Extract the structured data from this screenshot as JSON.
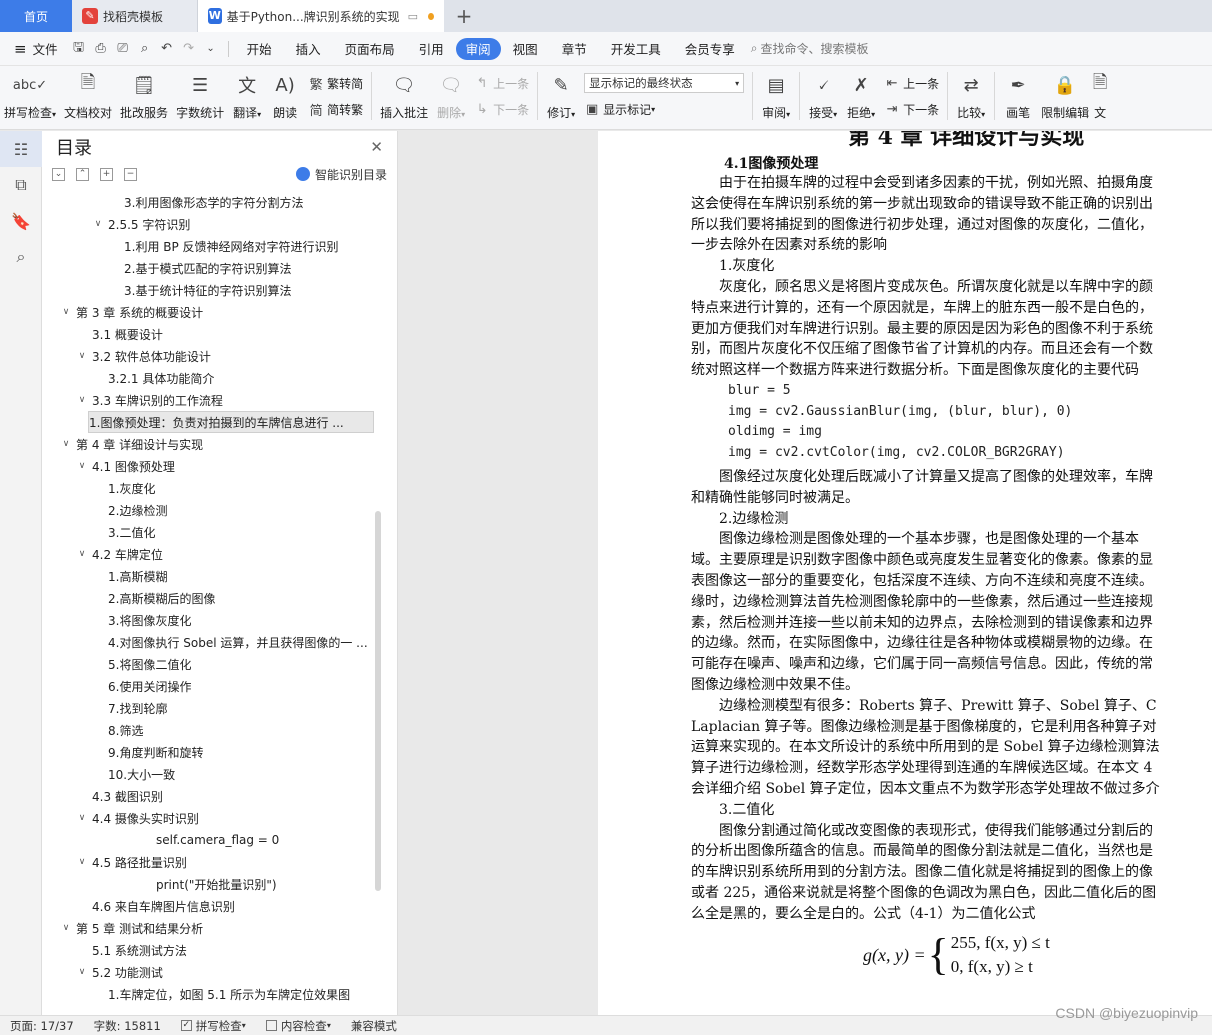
{
  "tabs": [
    {
      "label": "首页"
    },
    {
      "label": "找稻壳模板",
      "icon": "docer-icon"
    },
    {
      "label": "基于Python...牌识别系统的实现",
      "icon": "wps-writer-icon"
    }
  ],
  "menu": {
    "file": "文件",
    "items": [
      "开始",
      "插入",
      "页面布局",
      "引用",
      "审阅",
      "视图",
      "章节",
      "开发工具",
      "会员专享"
    ],
    "active": "审阅",
    "search_placeholder": "查找命令、搜索模板"
  },
  "ribbon": {
    "spellcheck": "拼写检查",
    "proofread": "文档校对",
    "batch": "批改服务",
    "wordcount": "字数统计",
    "translate": "翻译",
    "read": "朗读",
    "to_traditional": "繁转简",
    "to_simplified": "简转繁",
    "insert_comment": "插入批注",
    "delete": "删除",
    "prev": "上一条",
    "next": "下一条",
    "revise": "修订",
    "markup_select": "显示标记的最终状态",
    "show_markup": "显示标记",
    "review": "审阅",
    "accept": "接受",
    "reject": "拒绝",
    "prev2": "上一条",
    "next2": "下一条",
    "compare": "比较",
    "pen": "画笔",
    "restrict": "限制编辑",
    "doc_edge": "文"
  },
  "toc": {
    "title": "目录",
    "smart": "智能识别目录",
    "items": [
      {
        "text": "3.利用图像形态学的字符分割方法",
        "level": 3
      },
      {
        "text": "2.5.5 字符识别",
        "level": 2,
        "chev": "v"
      },
      {
        "text": "1.利用 BP 反馈神经网络对字符进行识别",
        "level": 3
      },
      {
        "text": "2.基于模式匹配的字符识别算法",
        "level": 3
      },
      {
        "text": "3.基于统计特征的字符识别算法",
        "level": 3
      },
      {
        "text": "第 3 章  系统的概要设计",
        "level": 0,
        "chev": "v"
      },
      {
        "text": "3.1 概要设计",
        "level": 1
      },
      {
        "text": "3.2 软件总体功能设计",
        "level": 1,
        "chev": "v"
      },
      {
        "text": "3.2.1 具体功能简介",
        "level": 2
      },
      {
        "text": "3.3 车牌识别的工作流程",
        "level": 1,
        "chev": "v"
      },
      {
        "text": "1.图像预处理：负责对拍摄到的车牌信息进行 ...",
        "level": 2,
        "selected": true
      },
      {
        "text": "第 4 章  详细设计与实现",
        "level": 0,
        "chev": "v"
      },
      {
        "text": "4.1 图像预处理",
        "level": 1,
        "chev": "v"
      },
      {
        "text": "1.灰度化",
        "level": 2
      },
      {
        "text": "2.边缘检测",
        "level": 2
      },
      {
        "text": "3.二值化",
        "level": 2
      },
      {
        "text": "4.2 车牌定位",
        "level": 1,
        "chev": "v"
      },
      {
        "text": "1.高斯模糊",
        "level": 2
      },
      {
        "text": "2.高斯模糊后的图像",
        "level": 2
      },
      {
        "text": "3.将图像灰度化",
        "level": 2
      },
      {
        "text": "4.对图像执行 Sobel 运算，并且获得图像的一 ...",
        "level": 2
      },
      {
        "text": "5.将图像二值化",
        "level": 2
      },
      {
        "text": "6.使用关闭操作",
        "level": 2
      },
      {
        "text": "7.找到轮廓",
        "level": 2
      },
      {
        "text": "8.筛选",
        "level": 2
      },
      {
        "text": "9.角度判断和旋转",
        "level": 2
      },
      {
        "text": "10.大小一致",
        "level": 2
      },
      {
        "text": "4.3 截图识别",
        "level": 1
      },
      {
        "text": "4.4 摄像头实时识别",
        "level": 1,
        "chev": "v"
      },
      {
        "text": "self.camera_flag = 0",
        "level": 4
      },
      {
        "text": "4.5 路径批量识别",
        "level": 1,
        "chev": "v"
      },
      {
        "text": "print(\"开始批量识别\")",
        "level": 4
      },
      {
        "text": "4.6 来自车牌图片信息识别",
        "level": 1
      },
      {
        "text": "第 5 章  测试和结果分析",
        "level": 0,
        "chev": "v"
      },
      {
        "text": "5.1 系统测试方法",
        "level": 1
      },
      {
        "text": "5.2 功能测试",
        "level": 1,
        "chev": "v"
      },
      {
        "text": "1.车牌定位，如图 5.1 所示为车牌定位效果图",
        "level": 2
      }
    ]
  },
  "doc": {
    "chapter": "第 4 章  详细设计与实现",
    "section": "4.1图像预处理",
    "lines": [
      "　　由于在拍摄车牌的过程中会受到诸多因素的干扰，例如光照、拍摄角度",
      "这会使得在车牌识别系统的第一步就出现致命的错误导致不能正确的识别出",
      "所以我们要将捕捉到的图像进行初步处理，通过对图像的灰度化，二值化，",
      "一步去除外在因素对系统的影响",
      "　　1.灰度化",
      "　　灰度化，顾名思义是将图片变成灰色。所谓灰度化就是以车牌中字的颜",
      "特点来进行计算的，还有一个原因就是，车牌上的脏东西一般不是白色的，",
      "更加方便我们对车牌进行识别。最主要的原因是因为彩色的图像不利于系统",
      "别，而图片灰度化不仅压缩了图像节省了计算机的内存。而且还会有一个数",
      "统对照这样一个数据方阵来进行数据分析。下面是图像灰度化的主要代码"
    ],
    "code": [
      "blur = 5",
      "img = cv2.GaussianBlur(img, (blur, blur), 0)",
      "oldimg = img",
      "img = cv2.cvtColor(img, cv2.COLOR_BGR2GRAY)"
    ],
    "lines2": [
      "　　图像经过灰度化处理后既减小了计算量又提高了图像的处理效率，车牌",
      "和精确性能够同时被满足。",
      "　　2.边缘检测",
      "　　图像边缘检测是图像处理的一个基本步骤，也是图像处理的一个基本",
      "域。主要原理是识别数字图像中颜色或亮度发生显著变化的像素。像素的显",
      "表图像这一部分的重要变化，包括深度不连续、方向不连续和亮度不连续。",
      "缘时，边缘检测算法首先检测图像轮廓中的一些像素，然后通过一些连接规",
      "素，然后检测并连接一些以前未知的边界点，去除检测到的错误像素和边界",
      "的边缘。然而，在实际图像中，边缘往往是各种物体或模糊景物的边缘。在",
      "可能存在噪声、噪声和边缘，它们属于同一高频信号信息。因此，传统的常",
      "图像边缘检测中效果不佳。",
      "　　边缘检测模型有很多：Roberts 算子、Prewitt 算子、Sobel 算子、C",
      "Laplacian 算子等。图像边缘检测是基于图像梯度的，它是利用各种算子对",
      "运算来实现的。在本文所设计的系统中所用到的是 Sobel 算子边缘检测算法",
      "算子进行边缘检测，经数学形态学处理得到连通的车牌候选区域。在本文 4",
      "会详细介绍 Sobel 算子定位，因本文重点不为数学形态学处理故不做过多介",
      "　　3.二值化",
      "　　图像分割通过简化或改变图像的表现形式，使得我们能够通过分割后的",
      "的分析出图像所蕴含的信息。而最简单的图像分割法就是二值化，当然也是",
      "的车牌识别系统所用到的分割方法。图像二值化就是将捕捉到的图像上的像",
      "或者 225，通俗来说就是将整个图像的色调改为黑白色，因此二值化后的图",
      "么全是黑的，要么全是白的。公式（4-1）为二值化公式"
    ],
    "formula": {
      "lhs": "g(x, y) =",
      "case1": "255, f(x, y) ≤ t",
      "case2": "0, f(x, y) ≥ t"
    }
  },
  "status": {
    "page": "页面: 17/37",
    "words": "字数: 15811",
    "spell": "拼写检查",
    "content": "内容检查",
    "compat": "兼容模式"
  },
  "watermark": "CSDN @biyezuopinvip",
  "colors": {
    "accent": "#3d7ce8",
    "docer_red": "#e3423b",
    "unsaved_dot": "#f0a020"
  }
}
